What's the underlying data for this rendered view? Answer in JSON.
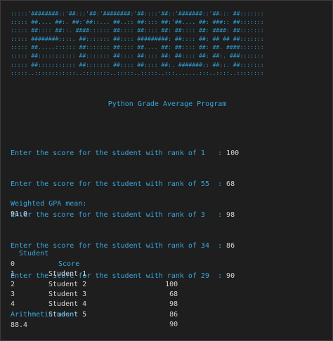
{
  "banner": {
    "lines": [
      ":::::'########::'##:::'##:'########:'##::::'##::'#######::'##::: ##:::::::",
      "::::: ##.... ##:. ##:'##::... ##..:: ##:::: ##:'##.... ##: ###:: ##:::::::",
      "::::: ##:::: ##::. ####:::::: ##:::: ##:::: ##: ##:::: ##: ####: ##:::::::",
      "::::: ########::::. ##::::::: ##:::: #########: ##:::: ##: ## ## ##:::::::",
      "::::: ##.....:::::: ##::::::: ##:::: ##.... ##: ##:::: ##: ##. ####:::::::",
      "::::: ##::::::::::: ##::::::: ##:::: ##:::: ##: ##:::: ##: ##:. ###:::::::",
      "::::: ##::::::::::: ##::::::: ##:::: ##:::: ##:. #######:: ##::. ##:::::::",
      ":::::..::::::::::::..::::::::..:::::..:::::..:::.......:::..::::..::::::::"
    ]
  },
  "title": "Python Grade Average Program",
  "prompts": [
    {
      "question": "Enter the score for the student with rank of 1   : ",
      "answer": "100"
    },
    {
      "question": "Enter the score for the student with rank of 55  : ",
      "answer": "68"
    },
    {
      "question": "Enter the score for the student with rank of 3   : ",
      "answer": "98"
    },
    {
      "question": "Enter the score for the student with rank of 34  : ",
      "answer": "86"
    },
    {
      "question": "Enter the score for the student with rank of 29  : ",
      "answer": "90"
    }
  ],
  "weighted": {
    "label": "Weighted GPA mean:",
    "value": "91.0"
  },
  "table": {
    "headers": {
      "student": "Student",
      "score": "Score"
    },
    "rows": [
      {
        "index": "0",
        "student": "Student 1",
        "score": "100"
      },
      {
        "index": "1",
        "student": "Student 2",
        "score": "68"
      },
      {
        "index": "2",
        "student": "Student 3",
        "score": "98"
      },
      {
        "index": "3",
        "student": "Student 4",
        "score": "86"
      },
      {
        "index": "4",
        "student": "Student 5",
        "score": "90"
      }
    ]
  },
  "arithmetic": {
    "label": "Arithmetic mean:",
    "value": "88.4"
  },
  "colors": {
    "background": "#1e1e1e",
    "accent": "#3aa6dd",
    "text": "#d4d4d4"
  }
}
